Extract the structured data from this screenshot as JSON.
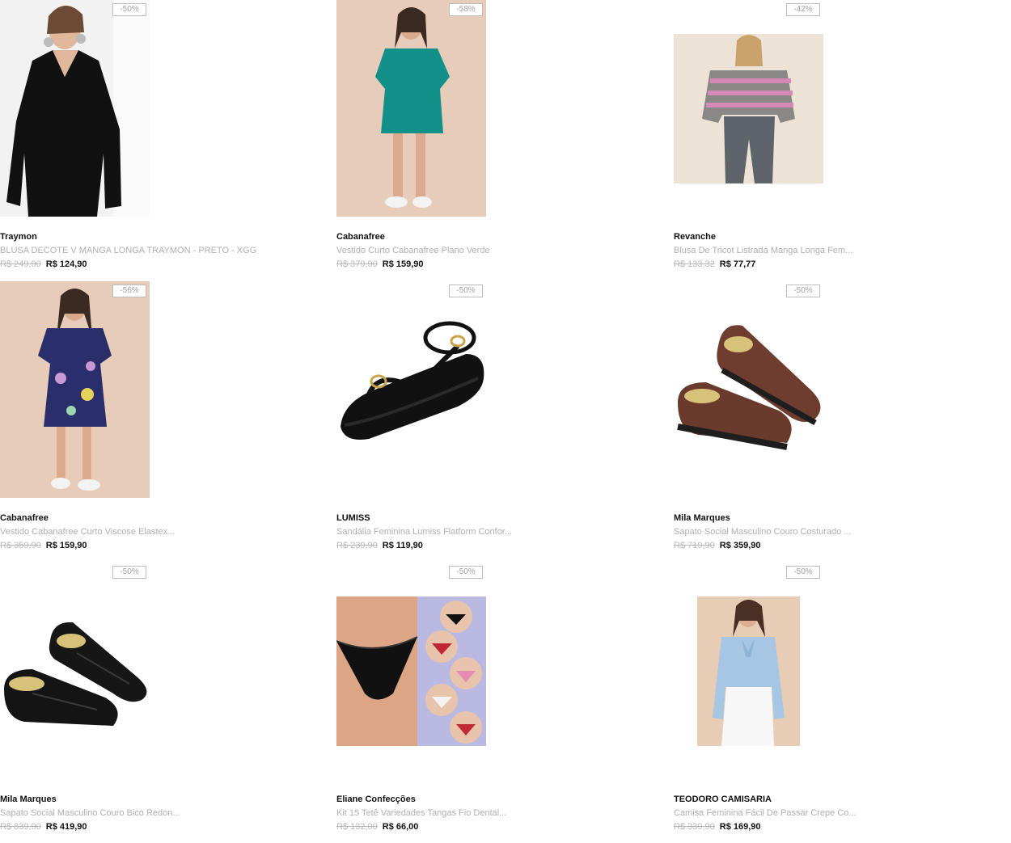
{
  "products": [
    {
      "brand": "Traymon",
      "title": "BLUSA DECOTE V MANGA LONGA TRAYMON - PRETO - XGG",
      "old_price": "R$ 249,90",
      "price": "R$ 124,90",
      "discount": "-50%",
      "image": "black-v-neck-blouse"
    },
    {
      "brand": "Cabanafree",
      "title": "Vestido Curto Cabanafree Plano Verde",
      "old_price": "R$ 379,90",
      "price": "R$ 159,90",
      "discount": "-58%",
      "image": "teal-short-dress"
    },
    {
      "brand": "Revanche",
      "title": "Blusa De Tricot Listrada Manga Longa Fem...",
      "old_price": "R$ 133,32",
      "price": "R$ 77,77",
      "discount": "-42%",
      "image": "striped-knit-sweater"
    },
    {
      "brand": "Cabanafree",
      "title": "Vestido Cabanafree Curto Viscose Elastex...",
      "old_price": "R$ 359,90",
      "price": "R$ 159,90",
      "discount": "-56%",
      "image": "floral-navy-dress"
    },
    {
      "brand": "LUMISS",
      "title": "Sandália Feminina Lumiss Flatform Confor...",
      "old_price": "R$ 239,90",
      "price": "R$ 119,90",
      "discount": "-50%",
      "image": "black-flatform-sandal"
    },
    {
      "brand": "Mila Marques",
      "title": "Sapato Social Masculino Couro Costurado ...",
      "old_price": "R$ 719,90",
      "price": "R$ 359,90",
      "discount": "-50%",
      "image": "brown-leather-loafers"
    },
    {
      "brand": "Mila Marques",
      "title": "Sapato Social Masculino Couro Bico Redon...",
      "old_price": "R$ 839,90",
      "price": "R$ 419,90",
      "discount": "-50%",
      "image": "black-leather-loafers"
    },
    {
      "brand": "Eliane Confecções",
      "title": "Kit 15 Tetê Variedades Tangas Fio Dental...",
      "old_price": "R$ 132,00",
      "price": "R$ 66,00",
      "discount": "-50%",
      "image": "lingerie-kit"
    },
    {
      "brand": "TEODORO CAMISARIA",
      "title": "Camisa Feminina Fácil De Passar Crepe Co...",
      "old_price": "R$ 339,90",
      "price": "R$ 169,90",
      "discount": "-50%",
      "image": "light-blue-blouse"
    }
  ]
}
